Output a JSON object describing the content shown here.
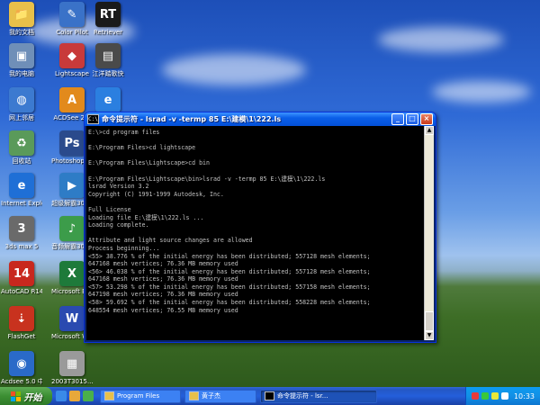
{
  "desktop": {
    "icons": [
      {
        "label": "我的文档",
        "glyph": "📁",
        "color": "#e8c04a"
      },
      {
        "label": "Color Pilot",
        "glyph": "✎",
        "color": "#3a72c8"
      },
      {
        "label": "Retriever",
        "glyph": "RT",
        "color": "#1a1a1a"
      },
      {
        "label": "我的电脑",
        "glyph": "▣",
        "color": "#6f8fb8"
      },
      {
        "label": "Lightscape",
        "glyph": "◆",
        "color": "#c83a3a"
      },
      {
        "label": "江洋踏歌快",
        "glyph": "▤",
        "color": "#4a4a4a"
      },
      {
        "label": "网上邻居",
        "glyph": "◍",
        "color": "#3c7ad0"
      },
      {
        "label": "ACDSee 2.0",
        "glyph": "A",
        "color": "#e28a1c"
      },
      {
        "label": "",
        "glyph": "e",
        "color": "#2b7fe0"
      },
      {
        "label": "回收站",
        "glyph": "♻",
        "color": "#5a9a5a"
      },
      {
        "label": "Photoshop 7.0.1",
        "glyph": "Ps",
        "color": "#2a4a8c"
      },
      {
        "label": "Internet Explorer",
        "glyph": "e",
        "color": "#1f6fd6"
      },
      {
        "label": "超级解霸3000",
        "glyph": "▶",
        "color": "#2e7cc6"
      },
      {
        "label": "3ds max 5",
        "glyph": "3",
        "color": "#6a6a6a"
      },
      {
        "label": "音频解霸3000",
        "glyph": "♪",
        "color": "#3c9c4a"
      },
      {
        "label": "AutoCAD R14",
        "glyph": "14",
        "color": "#c8281e"
      },
      {
        "label": "Microsoft Excel",
        "glyph": "X",
        "color": "#1e7a3a"
      },
      {
        "label": "FlashGet",
        "glyph": "⇣",
        "color": "#c8321e"
      },
      {
        "label": "Microsoft Word",
        "glyph": "W",
        "color": "#2a4ab0"
      },
      {
        "label": "Acdsee 5.0 中文版",
        "glyph": "◉",
        "color": "#2a6ac8"
      },
      {
        "label": "2003T3015...",
        "glyph": "▦",
        "color": "#9a9a9a"
      }
    ]
  },
  "window": {
    "title": "命令提示符 - lsrad -v -termp 85 E:\\建模\\1\\222.ls",
    "icon_text": "C:\\",
    "btn_min": "_",
    "btn_max": "□",
    "btn_close": "×",
    "console_lines": [
      "E:\\>cd program files",
      "",
      "E:\\Program Files>cd lightscape",
      "",
      "E:\\Program Files\\Lightscape>cd bin",
      "",
      "E:\\Program Files\\Lightscape\\bin>lsrad -v -termp 85 E:\\建模\\1\\222.ls",
      "lsrad Version 3.2",
      "Copyright (C) 1991-1999 Autodesk, Inc.",
      "",
      "Full License",
      "Loading file E:\\建模\\1\\222.ls ...",
      "Loading complete.",
      "",
      "Attribute and light source changes are allowed",
      "Process beginning...",
      "<55> 38.776 % of the initial energy has been distributed; 557128 mesh elements;",
      "647168 mesh vertices; 76.36 MB memory used",
      "<56> 46.038 % of the initial energy has been distributed; 557128 mesh elements;",
      "647168 mesh vertices; 76.36 MB memory used",
      "<57> 53.298 % of the initial energy has been distributed; 557158 mesh elements;",
      "647198 mesh vertices; 76.36 MB memory used",
      "<58> 59.692 % of the initial energy has been distributed; 558228 mesh elements;",
      "648554 mesh vertices; 76.55 MB memory used"
    ]
  },
  "taskbar": {
    "start_label": "开始",
    "quick_colors": [
      "#3a8ae8",
      "#e8a83a",
      "#4ab04a"
    ],
    "tasks": [
      {
        "label": "Program Files",
        "icon_color": "#e8c04a",
        "active": false
      },
      {
        "label": "黄子杰",
        "icon_color": "#e8c04a",
        "active": false
      },
      {
        "label": "命令提示符 - lsr...",
        "icon_color": "#000000",
        "active": true
      }
    ],
    "tray_colors": [
      "#e83a3a",
      "#3ac83a",
      "#e8e83a",
      "#ffffff"
    ],
    "clock": "10:33"
  }
}
